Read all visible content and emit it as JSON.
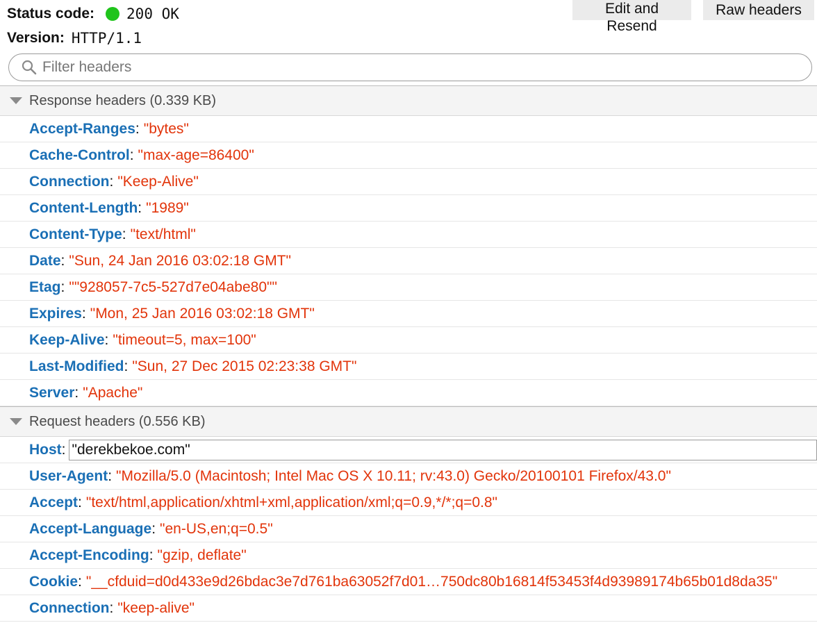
{
  "summary": {
    "status_label": "Status code:",
    "status_value": "200 OK",
    "status_color": "#1fc41b",
    "version_label": "Version:",
    "version_value": "HTTP/1.1"
  },
  "toolbar": {
    "edit_resend_label": "Edit and Resend",
    "raw_headers_label": "Raw headers"
  },
  "filter": {
    "placeholder": "Filter headers",
    "value": ""
  },
  "response_headers": {
    "title": "Response headers (0.339 KB)",
    "items": [
      {
        "name": "Accept-Ranges",
        "value": "\"bytes\""
      },
      {
        "name": "Cache-Control",
        "value": "\"max-age=86400\""
      },
      {
        "name": "Connection",
        "value": "\"Keep-Alive\""
      },
      {
        "name": "Content-Length",
        "value": "\"1989\""
      },
      {
        "name": "Content-Type",
        "value": "\"text/html\""
      },
      {
        "name": "Date",
        "value": "\"Sun, 24 Jan 2016 03:02:18 GMT\""
      },
      {
        "name": "Etag",
        "value": "\"\"928057-7c5-527d7e04abe80\"\""
      },
      {
        "name": "Expires",
        "value": "\"Mon, 25 Jan 2016 03:02:18 GMT\""
      },
      {
        "name": "Keep-Alive",
        "value": "\"timeout=5, max=100\""
      },
      {
        "name": "Last-Modified",
        "value": "\"Sun, 27 Dec 2015 02:23:38 GMT\""
      },
      {
        "name": "Server",
        "value": "\"Apache\""
      }
    ]
  },
  "request_headers": {
    "title": "Request headers (0.556 KB)",
    "items": [
      {
        "name": "Host",
        "value": "\"derekbekoe.com\""
      },
      {
        "name": "User-Agent",
        "value": "\"Mozilla/5.0 (Macintosh; Intel Mac OS X 10.11; rv:43.0) Gecko/20100101 Firefox/43.0\""
      },
      {
        "name": "Accept",
        "value": "\"text/html,application/xhtml+xml,application/xml;q=0.9,*/*;q=0.8\""
      },
      {
        "name": "Accept-Language",
        "value": "\"en-US,en;q=0.5\""
      },
      {
        "name": "Accept-Encoding",
        "value": "\"gzip, deflate\""
      },
      {
        "name": "Cookie",
        "value": "\"__cfduid=d0d433e9d26bdac3e7d761ba63052f7d01…750dc80b16814f53453f4d93989174b65b01d8da35\""
      },
      {
        "name": "Connection",
        "value": "\"keep-alive\""
      }
    ]
  },
  "colors": {
    "header_name": "#1a6fb5",
    "header_value": "#e2340a"
  },
  "icons": {
    "filter": "search-icon",
    "section_toggle": "triangle-down-icon"
  }
}
